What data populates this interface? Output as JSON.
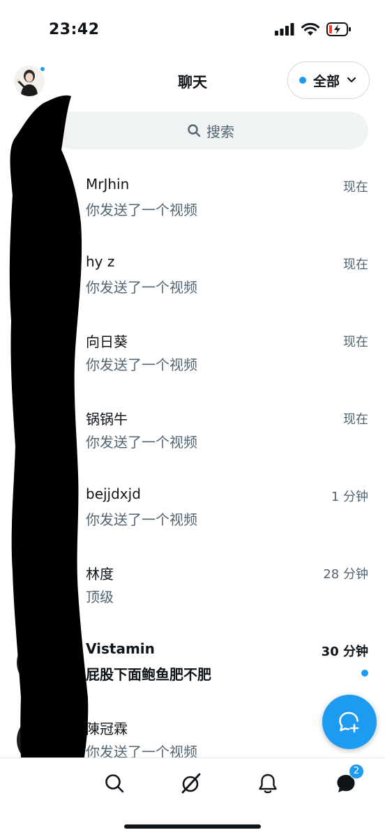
{
  "status_bar": {
    "time": "23:42"
  },
  "header": {
    "title": "聊天",
    "filter_label": "全部"
  },
  "search": {
    "placeholder": "搜索"
  },
  "conversations": [
    {
      "name": "MrJhin",
      "time": "现在",
      "preview": "你发送了一个视频",
      "unread": false
    },
    {
      "name": "hy z",
      "time": "现在",
      "preview": "你发送了一个视频",
      "unread": false
    },
    {
      "name": "向日葵",
      "time": "现在",
      "preview": "你发送了一个视频",
      "unread": false
    },
    {
      "name": "锅锅牛",
      "time": "现在",
      "preview": "你发送了一个视频",
      "unread": false
    },
    {
      "name": "bejjdxjd",
      "time": "1 分钟",
      "preview": "你发送了一个视频",
      "unread": false
    },
    {
      "name": "林度",
      "time": "28 分钟",
      "preview": "顶级",
      "unread": false
    },
    {
      "name": "Vistamin",
      "time": "30 分钟",
      "preview": "屁股下面鲍鱼肥不肥",
      "unread": true
    },
    {
      "name": "陳冠霖",
      "time": "",
      "preview": "你发送了一个视频",
      "unread": false
    }
  ],
  "bottom_nav": {
    "messages_badge": "2"
  },
  "colors": {
    "accent": "#1d9bf0",
    "text_primary": "#0f1419",
    "text_secondary": "#536471",
    "search_bg": "#eff3f4"
  }
}
